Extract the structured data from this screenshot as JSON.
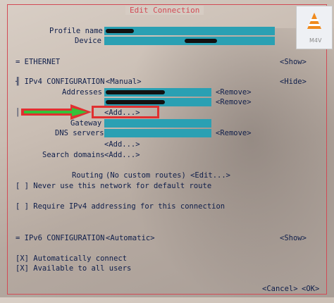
{
  "window": {
    "title": "Edit Connection"
  },
  "profile": {
    "name_label": "Profile name",
    "device_label": "Device"
  },
  "ethernet": {
    "label": "= ETHERNET",
    "show": "<Show>"
  },
  "ipv4": {
    "label": "╢ IPv4 CONFIGURATION",
    "mode": "<Manual>",
    "hide": "<Hide>",
    "addresses_label": "Addresses",
    "remove1": "<Remove>",
    "remove2": "<Remove>",
    "add_address": "<Add...>",
    "gateway_label": "Gateway",
    "dns_label": "DNS servers",
    "dns_remove": "<Remove>",
    "dns_add": "<Add...>",
    "search_label": "Search domains",
    "search_add": "<Add...>",
    "routing_label": "Routing",
    "routing_value": "(No custom routes) <Edit...>",
    "never_default": "[ ] Never use this network for default route",
    "require_ipv4": "[ ] Require IPv4 addressing for this connection"
  },
  "ipv6": {
    "label": "= IPv6 CONFIGURATION",
    "mode": "<Automatic>",
    "show": "<Show>"
  },
  "options": {
    "auto_connect": "[X] Automatically connect",
    "available_all": "[X] Available to all users"
  },
  "buttons": {
    "cancel": "<Cancel>",
    "ok": "<OK>"
  },
  "badge": {
    "label": "M4V"
  },
  "colors": {
    "field": "#2aa0b3",
    "border": "#d24a55",
    "text": "#0f1e4a",
    "highlight_box": "#e03030",
    "arrow": "#34c23a"
  }
}
